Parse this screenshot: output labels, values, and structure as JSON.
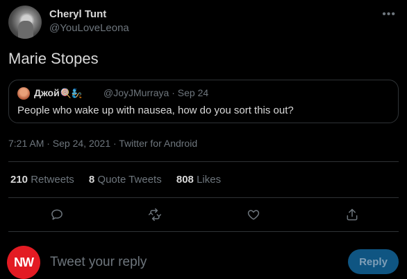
{
  "tweet": {
    "author_name": "Cheryl Tunt",
    "author_handle": "@YouLoveLeona",
    "text": "Marie Stopes",
    "quoted": {
      "author_name": "Джой",
      "author_emojis": "🍭🧞",
      "author_handle": "@JoyJMurraya · Sep 24",
      "text": "People who wake up with nausea, how do you sort this out?"
    },
    "meta": "7:21 AM · Sep 24, 2021 · Twitter for Android",
    "stats": {
      "retweets_count": "210",
      "retweets_label": "Retweets",
      "quote_count": "8",
      "quote_label": "Quote Tweets",
      "likes_count": "808",
      "likes_label": "Likes"
    }
  },
  "reply": {
    "avatar_text": "NW",
    "placeholder": "Tweet your reply",
    "button_label": "Reply"
  },
  "colors": {
    "background": "#000000",
    "text_primary": "#d9d9d9",
    "text_secondary": "#6e767d",
    "divider": "#2f3336",
    "reply_button": "#0f5582",
    "avatar_red": "#e31b23"
  },
  "icons": [
    "more-icon",
    "reply-icon",
    "retweet-icon",
    "like-icon",
    "share-icon"
  ]
}
